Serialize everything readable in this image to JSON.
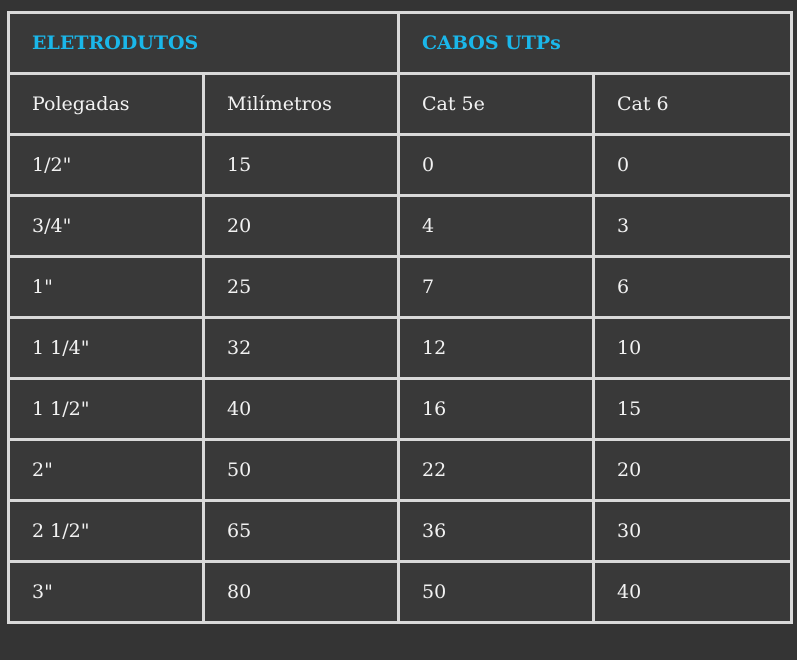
{
  "groups": {
    "eletrodutos": "ELETRODUTOS",
    "cabos": "CABOS UTPs"
  },
  "columns": [
    "Polegadas",
    "Milímetros",
    "Cat 5e",
    "Cat 6"
  ],
  "rows": [
    [
      "1/2\"",
      "15",
      "0",
      "0"
    ],
    [
      "3/4\"",
      "20",
      "4",
      "3"
    ],
    [
      "1\"",
      "25",
      "7",
      "6"
    ],
    [
      "1 1/4\"",
      "32",
      "12",
      "10"
    ],
    [
      "1 1/2\"",
      "40",
      "16",
      "15"
    ],
    [
      "2\"",
      "50",
      "22",
      "20"
    ],
    [
      "2 1/2\"",
      "65",
      "36",
      "30"
    ],
    [
      "3\"",
      "80",
      "50",
      "40"
    ]
  ],
  "colors": {
    "background": "#343434",
    "cell": "#393939",
    "border": "#d9d9d9",
    "group_text": "#1ab7ea",
    "text": "#f2f2f2"
  }
}
